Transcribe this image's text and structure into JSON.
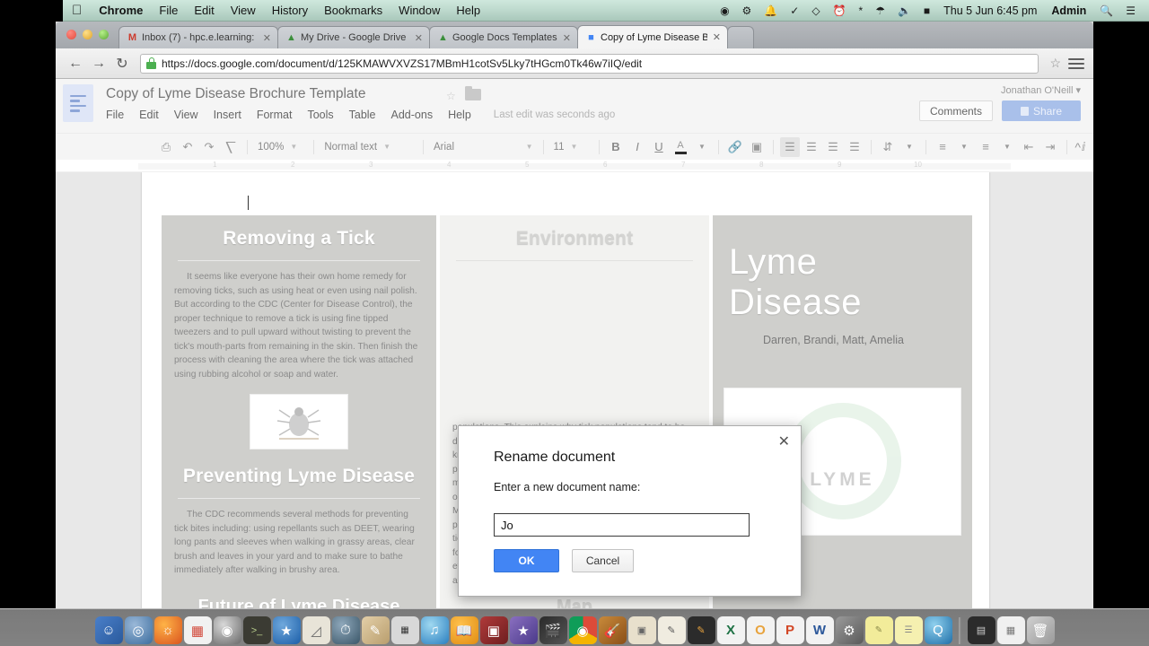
{
  "menubar": {
    "apple": "apple-logo",
    "items": [
      {
        "label": "Chrome",
        "bold": true
      },
      {
        "label": "File",
        "bold": false
      },
      {
        "label": "Edit",
        "bold": false
      },
      {
        "label": "View",
        "bold": false
      },
      {
        "label": "History",
        "bold": false
      },
      {
        "label": "Bookmarks",
        "bold": false
      },
      {
        "label": "Window",
        "bold": false
      },
      {
        "label": "Help",
        "bold": false
      }
    ],
    "status_icons": [
      "record-icon",
      "app-status-icon",
      "bell-icon",
      "checkmark-icon",
      "dropbox-icon",
      "timemachine-icon",
      "bluetooth-icon",
      "wifi-icon",
      "volume-icon",
      "battery-icon"
    ],
    "datetime": "Thu 5 Jun  6:45 pm",
    "user": "Admin",
    "search_icon": "search-icon",
    "notification_icon": "notification-center-icon"
  },
  "browser": {
    "tabs": [
      {
        "label": "Inbox (7) - hpc.e.learning:",
        "favicon": "gmail-icon",
        "active": false
      },
      {
        "label": "My Drive - Google Drive",
        "favicon": "drive-icon",
        "active": false
      },
      {
        "label": "Google Docs Templates",
        "favicon": "drive-icon",
        "active": false
      },
      {
        "label": "Copy of Lyme Disease Broc",
        "favicon": "docs-icon",
        "active": true
      }
    ],
    "new_tab_label": "+",
    "back_icon": "back-arrow-icon",
    "forward_icon": "forward-arrow-icon",
    "reload_icon": "reload-icon",
    "url": "https://docs.google.com/document/d/125KMAWVXVZS17MBmH1cotSv5Lky7tHGcm0Tk46w7iIQ/edit",
    "bookmark_icon": "star-icon",
    "menu_icon": "chrome-menu-icon"
  },
  "docs": {
    "title": "Copy of Lyme Disease Brochure Template",
    "menus": [
      "File",
      "Edit",
      "View",
      "Insert",
      "Format",
      "Tools",
      "Table",
      "Add-ons",
      "Help"
    ],
    "last_edit": "Last edit was seconds ago",
    "account_name": "Jonathan O'Neill",
    "comments_label": "Comments",
    "share_label": "Share",
    "toolbar": {
      "zoom": "100%",
      "paragraph_style": "Normal text",
      "font": "Arial",
      "font_size": "11",
      "bold": "B",
      "italic": "I",
      "underline": "U",
      "text_color": "A",
      "icons": [
        "print-icon",
        "undo-icon",
        "redo-icon",
        "paint-format-icon",
        "link-icon",
        "insert-image-icon",
        "align-left-icon",
        "align-center-icon",
        "align-right-icon",
        "align-justify-icon",
        "line-spacing-icon",
        "numbered-list-icon",
        "bulleted-list-icon",
        "decrease-indent-icon",
        "increase-indent-icon",
        "clear-formatting-icon",
        "collapse-toolbar-icon"
      ]
    },
    "ruler_marks": [
      "1",
      "2",
      "3",
      "4",
      "5",
      "6",
      "7",
      "8",
      "9",
      "10"
    ]
  },
  "document": {
    "column_one": {
      "heading": "Removing a Tick",
      "paragraph": "It seems like everyone has their own home remedy for removing ticks, such as using heat or even using nail polish. But according to the CDC (Center for Disease Control), the proper technique to remove a tick is using fine tipped tweezers and to pull upward without twisting to prevent  the tick's mouth-parts from remaining in the skin. Then finish the process with cleaning the area where the tick was attached using rubbing alcohol or soap and water.",
      "image_alt": "tick-illustration",
      "heading_two": "Preventing Lyme Disease",
      "paragraph_two": "The CDC recommends several methods for preventing tick bites including: using repellants such as DEET, wearing long pants and sleeves when walking in grassy areas, clear brush and leaves in your yard and to make sure to bathe immediately after walking in brushy area.",
      "heading_three": "Future of Lyme Disease"
    },
    "column_two": {
      "heading": "Environment",
      "paragraph": "populations. This explains why tick populations tend to be down a year and a half after a severe winter. Cold winters knock mouse populations; this in turn reduces the probability of a tick larvae finding a host in the spring and maturing the following year. The same effect can be observed with other rodents and mammals, such as deer. Many believe that dry summers cause a dip in tick populations for that year, but they actually cause the young ticks to perish, causing a decrease in population the following year. It is vital to understand the environment's effect on ticks so that we can better defend ourselves against Lyme disease.",
      "heading_two": "Map"
    },
    "column_three": {
      "title": "Lyme Disease",
      "authors": "Darren, Brandi, Matt, Amelia",
      "logo_text": "LYME"
    }
  },
  "modal": {
    "title": "Rename document",
    "prompt": "Enter a new document name:",
    "input_value": "Jo",
    "ok_label": "OK",
    "cancel_label": "Cancel",
    "close_icon": "close-icon"
  },
  "dock": {
    "icons": [
      "finder-icon",
      "dashboard-icon",
      "firefox-icon",
      "launchpad-icon",
      "dvd-player-icon",
      "terminal-icon",
      "app-store-icon",
      "preview-icon",
      "time-machine-icon",
      "address-book-icon",
      "calculator-icon",
      "itunes-icon",
      "ibooks-icon",
      "photo-booth-icon",
      "imovie-icon",
      "final-cut-icon",
      "chrome-icon",
      "garageband-icon",
      "keynote-icon",
      "pages-icon",
      "illustrator-icon",
      "excel-icon",
      "outlook-icon",
      "powerpoint-icon",
      "word-icon",
      "system-preferences-icon",
      "printer-icon",
      "stickies-icon",
      "quicktime-icon",
      "downloads-stack-icon",
      "documents-stack-icon",
      "trash-icon"
    ]
  },
  "colors": {
    "accent_blue": "#4285f4",
    "share_blue": "#a9c0ea",
    "brochure_gray": "#cfcfcc",
    "menubar_green": "#bdd9cd"
  }
}
